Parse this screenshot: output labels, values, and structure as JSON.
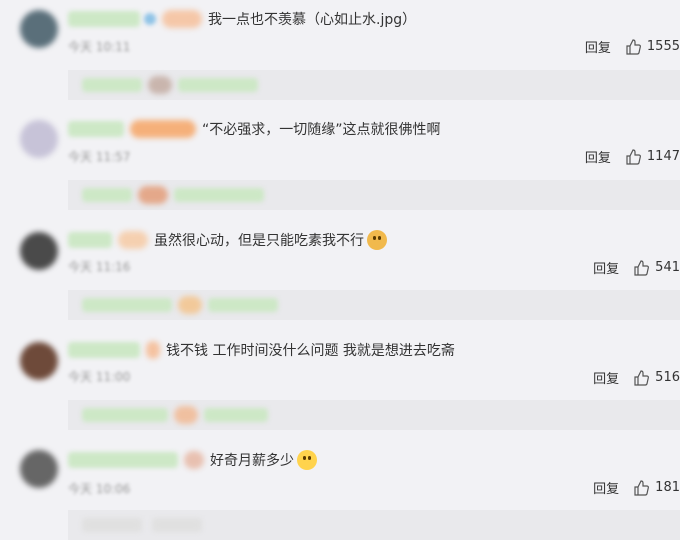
{
  "comments": [
    {
      "text": "我一点也不羡慕（心如止水.jpg）",
      "time": "今天 10:11",
      "reply_label": "回复",
      "likes": "1555",
      "avatar_color": "#5a6f7a",
      "name_color": "#cde8c6",
      "has_emoji": false
    },
    {
      "text": "“不必强求，一切随缘”这点就很佛性啊",
      "time": "今天 11:57",
      "reply_label": "回复",
      "likes": "1147",
      "avatar_color": "#c7c3d8",
      "name_color": "#cde8c6",
      "has_emoji": false
    },
    {
      "text": "虽然很心动，但是只能吃素我不行",
      "time": "今天 11:16",
      "reply_label": "回复",
      "likes": "541",
      "avatar_color": "#4a4a4a",
      "name_color": "#cde8c6",
      "has_emoji": true,
      "emoji_icon": "dog-face-emoji"
    },
    {
      "text": "钱不钱 工作时间没什么问题 我就是想进去吃斋",
      "time": "今天 11:00",
      "reply_label": "回复",
      "likes": "516",
      "avatar_color": "#6e4a3a",
      "name_color": "#cde8c6",
      "has_emoji": false
    },
    {
      "text": "好奇月薪多少",
      "time": "今天 10:06",
      "reply_label": "回复",
      "likes": "181",
      "avatar_color": "#666666",
      "name_color": "#cde8c6",
      "has_emoji": true,
      "emoji_icon": "laugh-cry-emoji"
    }
  ],
  "colors": {
    "background": "#f2f2f5",
    "reply_box": "#e9e9ec",
    "blurred_name": "#cde8c6",
    "blurred_badge": "#f5b07a"
  }
}
